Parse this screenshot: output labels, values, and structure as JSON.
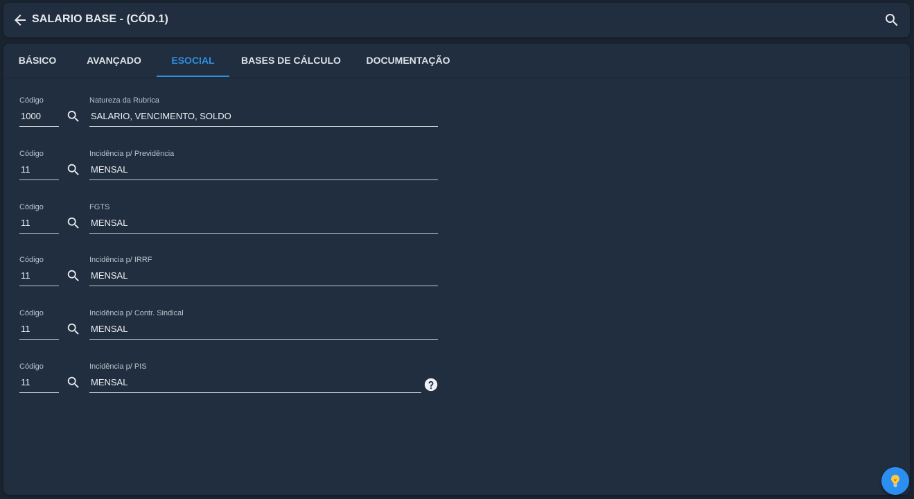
{
  "header": {
    "title": "SALARIO BASE - (CÓD.1)",
    "back_icon": "arrow-left-icon",
    "search_icon": "search-icon"
  },
  "tabs": [
    {
      "label": "BÁSICO",
      "active": false
    },
    {
      "label": "AVANÇADO",
      "active": false
    },
    {
      "label": "ESOCIAL",
      "active": true
    },
    {
      "label": "BASES DE CÁLCULO",
      "active": false
    },
    {
      "label": "DOCUMENTAÇÃO",
      "active": false
    }
  ],
  "rows": [
    {
      "code_label": "Código",
      "code": "1000",
      "desc_label": "Natureza da Rubrica",
      "desc": "SALARIO, VENCIMENTO, SOLDO"
    },
    {
      "code_label": "Código",
      "code": "11",
      "desc_label": "Incidência p/ Previdência",
      "desc": "MENSAL"
    },
    {
      "code_label": "Código",
      "code": "11",
      "desc_label": "FGTS",
      "desc": "MENSAL"
    },
    {
      "code_label": "Código",
      "code": "11",
      "desc_label": "Incidência p/ IRRF",
      "desc": "MENSAL"
    },
    {
      "code_label": "Código",
      "code": "11",
      "desc_label": "Incidência p/ Contr. Sindical",
      "desc": "MENSAL"
    },
    {
      "code_label": "Código",
      "code": "11",
      "desc_label": "Incidência p/ PIS",
      "desc": "MENSAL"
    }
  ],
  "help_icon": "question-circle-icon",
  "fab_icon": "lightbulb-icon",
  "colors": {
    "background": "#1a2330",
    "surface": "#212e3f",
    "accent": "#2f8fe0",
    "fab": "#2a8ff0"
  }
}
